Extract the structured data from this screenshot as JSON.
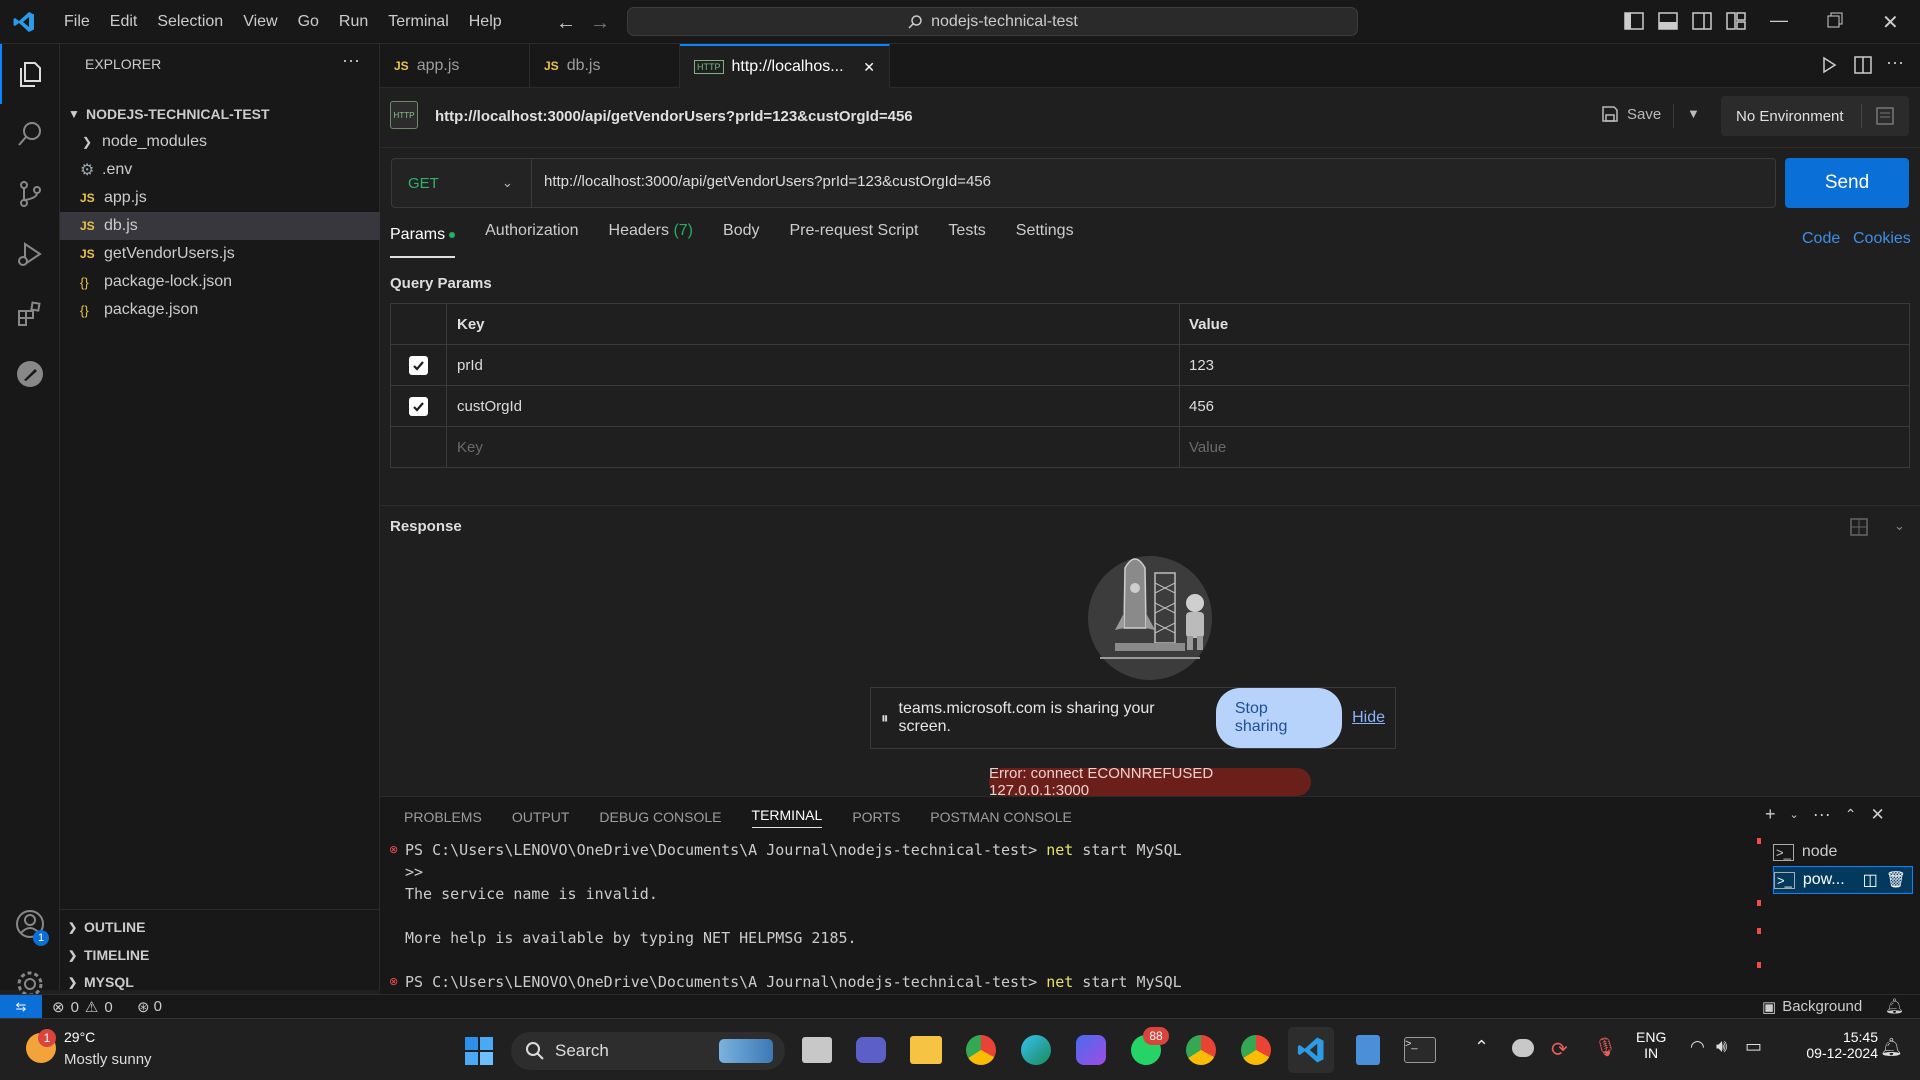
{
  "menu": [
    "File",
    "Edit",
    "Selection",
    "View",
    "Go",
    "Run",
    "Terminal",
    "Help"
  ],
  "command_center": "nodejs-technical-test",
  "explorer": {
    "title": "EXPLORER",
    "project": "NODEJS-TECHNICAL-TEST",
    "items": [
      {
        "label": "node_modules",
        "kind": "folder"
      },
      {
        "label": ".env",
        "kind": "gear"
      },
      {
        "label": "app.js",
        "kind": "js"
      },
      {
        "label": "db.js",
        "kind": "js"
      },
      {
        "label": "getVendorUsers.js",
        "kind": "js"
      },
      {
        "label": "package-lock.json",
        "kind": "json"
      },
      {
        "label": "package.json",
        "kind": "json"
      }
    ],
    "sections": [
      "OUTLINE",
      "TIMELINE",
      "MYSQL"
    ]
  },
  "tabs": [
    {
      "badge": "JS",
      "label": "app.js"
    },
    {
      "badge": "JS",
      "label": "db.js"
    },
    {
      "badge": "HTTP",
      "label": "http://localhos..."
    }
  ],
  "request": {
    "title_url": "http://localhost:3000/api/getVendorUsers?prId=123&custOrgId=456",
    "save_label": "Save",
    "environment": "No Environment",
    "method": "GET",
    "url": "http://localhost:3000/api/getVendorUsers?prId=123&custOrgId=456",
    "send_label": "Send",
    "tabs": [
      "Params",
      "Authorization",
      "Headers",
      "Body",
      "Pre-request Script",
      "Tests",
      "Settings"
    ],
    "headers_count": "(7)",
    "code_label": "Code",
    "cookies_label": "Cookies",
    "query_params_title": "Query Params",
    "col_key": "Key",
    "col_value": "Value",
    "params": [
      {
        "key": "prId",
        "value": "123",
        "checked": true
      },
      {
        "key": "custOrgId",
        "value": "456",
        "checked": true
      }
    ],
    "placeholder_key": "Key",
    "placeholder_value": "Value"
  },
  "response": {
    "title": "Response",
    "share_text": "teams.microsoft.com is sharing your screen.",
    "stop_label": "Stop sharing",
    "hide_label": "Hide",
    "error": "Error: connect ECONNREFUSED 127.0.0.1:3000"
  },
  "panel": {
    "tabs": [
      "PROBLEMS",
      "OUTPUT",
      "DEBUG CONSOLE",
      "TERMINAL",
      "PORTS",
      "POSTMAN CONSOLE"
    ],
    "lines": {
      "l1_prompt": "PS C:\\Users\\LENOVO\\OneDrive\\Documents\\A Journal\\nodejs-technical-test> ",
      "l1_cmd": "net",
      "l1_args": " start MySQL",
      "l2": ">>",
      "l3": "The service name is invalid.",
      "l4": "More help is available by typing NET HELPMSG 2185.",
      "l5_prompt": "PS C:\\Users\\LENOVO\\OneDrive\\Documents\\A Journal\\nodejs-technical-test> ",
      "l5_cmd": "net",
      "l5_args": " start MySQL"
    },
    "terminals": [
      "node",
      "pow..."
    ]
  },
  "status": {
    "errors": "0",
    "warnings": "0",
    "ports": "0",
    "background": "Background"
  },
  "taskbar": {
    "temp": "29°C",
    "weather": "Mostly sunny",
    "weather_badge": "1",
    "search": "Search",
    "whatsapp_badge": "88",
    "lang1": "ENG",
    "lang2": "IN",
    "time": "15:45",
    "date": "09-12-2024"
  },
  "accounts_badge": "1",
  "colors": {
    "accent": "#0a6fd6",
    "error": "#f14c4c",
    "js": "#e8c54a",
    "green": "#27ae60"
  }
}
